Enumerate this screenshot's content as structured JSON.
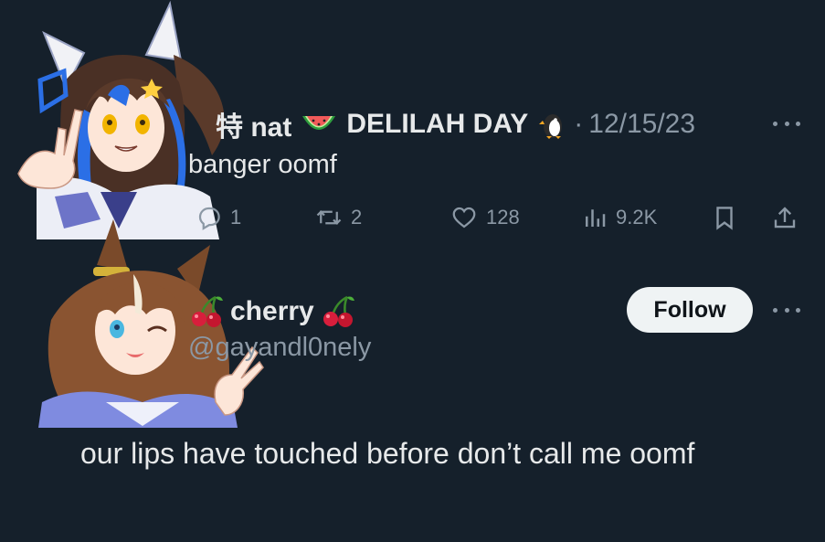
{
  "tweet_1": {
    "name_prefix": "特 nat",
    "name_suffix": "DELILAH DAY",
    "separator": "·",
    "date": "12/15/23",
    "text": "banger oomf",
    "actions": {
      "replies": "1",
      "reposts": "2",
      "likes": "128",
      "views": "9.2K"
    },
    "icons": {
      "name_emoji_1": "watermelon-icon",
      "name_emoji_2": "penguin-icon",
      "more": "more-icon",
      "reply": "reply-icon",
      "repost": "repost-icon",
      "like": "heart-icon",
      "views": "views-icon",
      "bookmark": "bookmark-icon",
      "share": "share-icon"
    }
  },
  "tweet_2": {
    "name": "cherry",
    "handle": "@gayandl0nely",
    "follow_label": "Follow",
    "text": "our lips have touched before don’t call me oomf",
    "icons": {
      "name_emoji": "cherries-icon",
      "more": "more-icon"
    }
  },
  "colors": {
    "background": "#15202b",
    "primary_text": "#e7e9ea",
    "secondary_text": "#8b98a5",
    "follow_button_bg": "#eff3f4",
    "follow_button_text": "#0f1419"
  }
}
